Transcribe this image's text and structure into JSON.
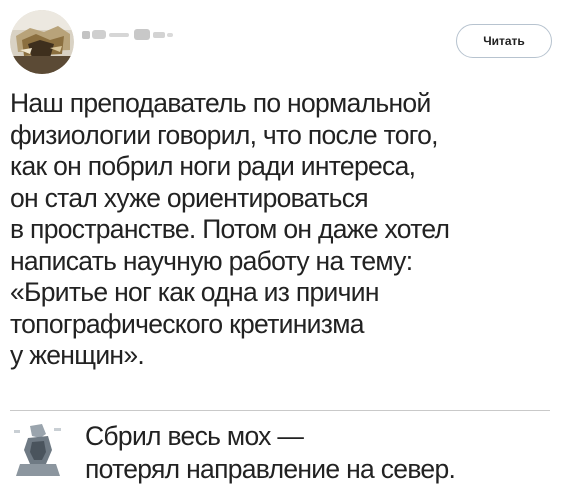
{
  "post": {
    "follow_label": "Читать",
    "avatar_icon": "user-avatar-icon",
    "text_lines": [
      "Наш преподаватель по нормальной",
      "физиологии говорил, что после того,",
      "как он побрил ноги ради интереса,",
      "он стал хуже ориентироваться",
      "в пространстве. Потом он даже хотел",
      "написать научную работу на тему:",
      "«Бритье ног как одна из причин",
      "топографического кретинизма",
      "у женщин»."
    ]
  },
  "reply": {
    "avatar_icon": "user-avatar-icon",
    "text_lines": [
      "Сбрил весь мох —",
      "потерял направление на север."
    ]
  },
  "colors": {
    "button_border": "#b7c3cf",
    "text": "#222222",
    "divider": "#c9c9c9"
  }
}
